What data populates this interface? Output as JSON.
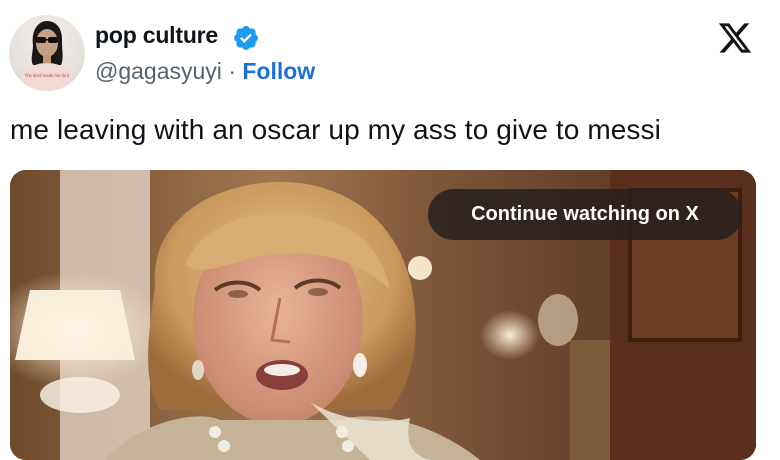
{
  "author": {
    "display_name": "pop culture",
    "handle": "@gagasyuyi",
    "separator": "·",
    "follow_label": "Follow",
    "verified_icon": "verified-badge-icon",
    "avatar_shirt_text": "The devil made me do it"
  },
  "brand": {
    "logo_icon": "x-logo-icon"
  },
  "tweet": {
    "text": "me leaving with an oscar up my ass to give to messi"
  },
  "media": {
    "overlay_button_label": "Continue watching on X"
  },
  "colors": {
    "link_blue": "#1d6fd6",
    "verified_blue": "#1d9bf0",
    "text_primary": "#0f1419",
    "text_secondary": "#536471",
    "overlay_bg": "#26201e"
  }
}
